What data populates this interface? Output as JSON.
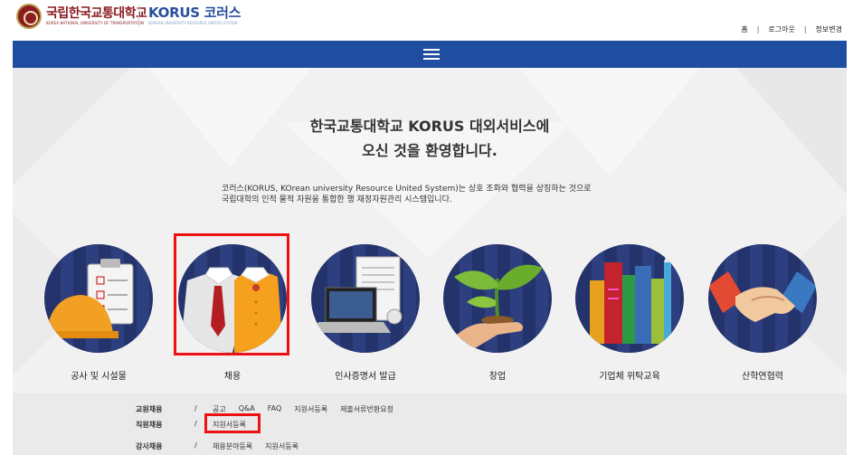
{
  "header": {
    "knut_name": "국립한국교통대학교",
    "knut_sub": "KOREA NATIONAL UNIVERSITY OF TRANSPORTATION",
    "korus_name": "KORUS 코러스",
    "korus_sub": "KOREAN UNIVERSITY RESOURCE UNITED SYSTEM",
    "links": [
      "홈",
      "로그아웃",
      "정보변경"
    ]
  },
  "hero": {
    "welcome_line1": "한국교통대학교 KORUS 대외서비스에",
    "welcome_line2": "오신 것을 환영합니다.",
    "desc_line1": "코러스(KORUS, KOrean university Resource United System)는 상호 조화와 협력을 상징하는 것으로",
    "desc_line2": "국립대학의 인적 물적 자원을 통합한 행 재정자원관리 시스템입니다."
  },
  "services": [
    {
      "label": "공사 및 시설물",
      "icon": "construction-icon"
    },
    {
      "label": "채용",
      "icon": "recruitment-icon"
    },
    {
      "label": "인사증명서 발급",
      "icon": "certificate-icon"
    },
    {
      "label": "창업",
      "icon": "sprout-icon"
    },
    {
      "label": "기업체 위탁교육",
      "icon": "books-icon"
    },
    {
      "label": "산학연협력",
      "icon": "handshake-icon"
    }
  ],
  "menu": {
    "rows": [
      {
        "category": "교원채용",
        "links": [
          "공고",
          "Q&A",
          "FAQ",
          "지원서등록",
          "제출서류반환요청"
        ]
      },
      {
        "category": "직원채용",
        "links": [
          "지원서등록"
        ]
      },
      {
        "category": "강사채용",
        "links": [
          "채용분야등록",
          "지원서등록"
        ]
      }
    ]
  },
  "colors": {
    "navbar": "#1f4ea1",
    "highlight": "#ee1111",
    "brand_knut": "#8a1c22",
    "brand_korus": "#2a4f9c"
  }
}
